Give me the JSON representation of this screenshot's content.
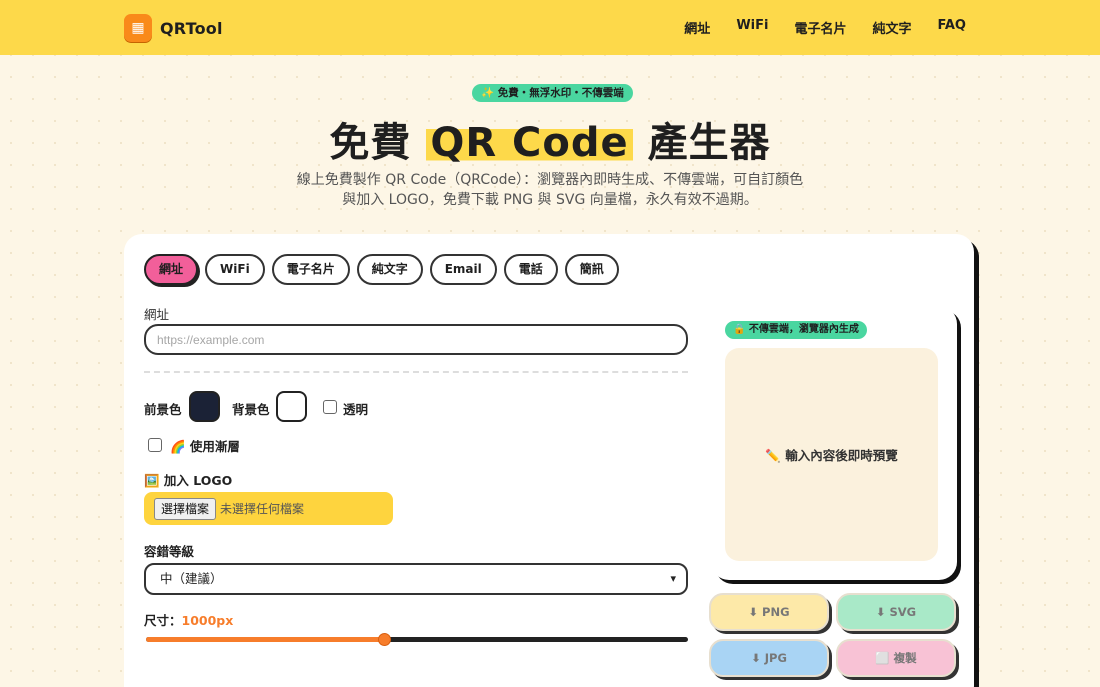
{
  "header": {
    "logo_text": "QRTool",
    "nav": [
      "網址",
      "WiFi",
      "電子名片",
      "純文字",
      "FAQ"
    ]
  },
  "hero": {
    "badge": "✨ 免費・無浮水印・不傳雲端",
    "title_pre": "免費",
    "title_hl": "QR Code",
    "title_post": "產生器",
    "subtitle_line1": "線上免費製作 QR Code（QRCode）：瀏覽器內即時生成、不傳雲端，可自訂顏色",
    "subtitle_line2": "與加入 LOGO，免費下載 PNG 與 SVG 向量檔，永久有效不過期。"
  },
  "tabs": [
    "網址",
    "WiFi",
    "電子名片",
    "純文字",
    "Email",
    "電話",
    "簡訊"
  ],
  "active_tab": "網址",
  "form": {
    "url_label": "網址",
    "url_placeholder": "https://example.com",
    "url_value": "",
    "fg_label": "前景色",
    "fg_color": "#1b2236",
    "bg_label": "背景色",
    "bg_color": "#ffffff",
    "transparent_label": "透明",
    "transparent_checked": false,
    "gradient_label": "🌈 使用漸層",
    "gradient_checked": false,
    "logo_label": "🖼️ 加入 LOGO",
    "file_button": "選擇檔案",
    "file_status": "未選擇任何檔案",
    "ec_label": "容錯等級",
    "ec_value": "中（建議）",
    "size_label": "尺寸：",
    "size_value": "1000px",
    "size_fraction": 0.44
  },
  "preview": {
    "badge": "🔒 不傳雲端，瀏覽器內生成",
    "placeholder": "✏️ 輸入內容後即時預覽"
  },
  "downloads": [
    {
      "label": "⬇ PNG",
      "color": "#fde9a8"
    },
    {
      "label": "⬇ SVG",
      "color": "#a9e9c8"
    },
    {
      "label": "⬇ JPG",
      "color": "#a9d4f4"
    },
    {
      "label": "⬜ 複製",
      "color": "#f8c2d5"
    }
  ],
  "colors": {
    "header": "#fdd94a",
    "accent_pink": "#f25f9a",
    "accent_orange": "#f77d2b",
    "accent_green": "#4ad6a0"
  }
}
